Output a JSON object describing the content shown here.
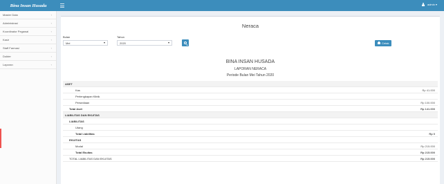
{
  "app": {
    "logo_text": "Bina Insan Husada",
    "user_label": "admin ▾"
  },
  "sidebar": {
    "items": [
      {
        "label": "Master Data"
      },
      {
        "label": "Administrasi"
      },
      {
        "label": "Koordinator Pegawai"
      },
      {
        "label": "Kasir"
      },
      {
        "label": "Staff Farmasi"
      },
      {
        "label": "Dokter"
      },
      {
        "label": "Laporan"
      }
    ]
  },
  "page": {
    "title": "Neraca",
    "bulan_label": "Bulan",
    "bulan_value": "Mei",
    "tahun_label": "Tahun",
    "tahun_value": "2020",
    "print_label": "Cetak"
  },
  "report": {
    "org": "BINA INSAN HUSADA",
    "title": "LAPORAN NERACA",
    "period": "Periode Bulan Mei Tahun 2020",
    "rows": [
      {
        "name": "ASET",
        "value": ""
      },
      {
        "name": "Kas",
        "value": "Rp 41.000"
      },
      {
        "name": "Perlengkapan Klinik",
        "value": ""
      },
      {
        "name": "Persediaan",
        "value": "Rp 100.000"
      },
      {
        "name": "Total Aset",
        "value": "Rp 141.000"
      },
      {
        "name": "LIABILITAS DAN EKUITAS",
        "value": ""
      },
      {
        "name": "LIABILITAS",
        "value": ""
      },
      {
        "name": "Utang",
        "value": ""
      },
      {
        "name": "Total Liabilitas",
        "value": "Rp 0"
      },
      {
        "name": "EKUITAS",
        "value": ""
      },
      {
        "name": "Modal",
        "value": "Rp 215.000"
      },
      {
        "name": "Total Ekuitas",
        "value": "Rp 215.000"
      },
      {
        "name": "TOTAL LIABILITAS DAN EKUITAS",
        "value": "Rp 215.000"
      }
    ]
  }
}
